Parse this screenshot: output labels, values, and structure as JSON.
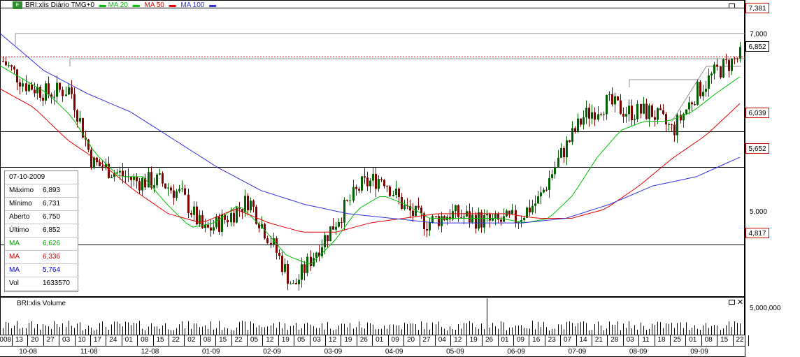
{
  "legend": {
    "symbol": "BRI:xlis Diário TMG+0",
    "ma20": "MA 20",
    "ma50": "MA 50",
    "ma100": "MA 100"
  },
  "volume_title": "BRI:xlis Volume",
  "volume_axis_label": "5,000,000",
  "price_axis_labels": [
    "7,000",
    "5,000"
  ],
  "price_tags": [
    {
      "value": "7,381",
      "color": "#cc0000"
    },
    {
      "value": "6,852",
      "color": "#000000"
    },
    {
      "value": "6,039",
      "color": "#cc0000"
    },
    {
      "value": "5,652",
      "color": "#cc0000"
    },
    {
      "value": "4,817",
      "color": "#cc0000"
    }
  ],
  "info": {
    "date": "07-10-2009",
    "rows": [
      {
        "k": "Máximo",
        "v": "6,893",
        "color": "#000000"
      },
      {
        "k": "Mínimo",
        "v": "6,731",
        "color": "#000000"
      },
      {
        "k": "Aberto",
        "v": "6,750",
        "color": "#000000"
      },
      {
        "k": "Último",
        "v": "6,852",
        "color": "#000000"
      },
      {
        "k": "MA",
        "v": "6,626",
        "color": "#00a000"
      },
      {
        "k": "MA",
        "v": "6,336",
        "color": "#d00000"
      },
      {
        "k": "MA",
        "v": "5,764",
        "color": "#0000cc"
      },
      {
        "k": "Vol",
        "v": "1633570",
        "color": "#000000"
      }
    ]
  },
  "x_day_labels": [
    "2008",
    "13",
    "20",
    "27",
    "03",
    "10",
    "17",
    "24",
    "01",
    "08",
    "15",
    "22",
    "02",
    "08",
    "15",
    "22",
    "05",
    "12",
    "19",
    "05",
    "03",
    "12",
    "19",
    "26",
    "01",
    "09",
    "20",
    "27",
    "04",
    "12",
    "19",
    "26",
    "01",
    "09",
    "16",
    "23",
    "07",
    "14",
    "21",
    "28",
    "03",
    "11",
    "18",
    "25",
    "01",
    "08",
    "15",
    "22"
  ],
  "x_month_labels": [
    "10-08",
    "11-08",
    "12-08",
    "01-09",
    "02-09",
    "03-09",
    "04-09",
    "05-09",
    "06-09",
    "07-09",
    "08-09",
    "09-09"
  ],
  "colors": {
    "ma20": "#00c000",
    "ma50": "#e00000",
    "ma100": "#3030e0",
    "up": "#006000",
    "down": "#800000"
  },
  "chart_data": {
    "type": "line",
    "title": "BRI:xlis Diário TMG+0",
    "ylim": [
      4.25,
      7.4
    ],
    "horizontal_levels": [
      7.381,
      6.852,
      6.039,
      5.652,
      4.817
    ],
    "months": [
      "10-08",
      "11-08",
      "12-08",
      "01-09",
      "02-09",
      "03-09",
      "04-09",
      "05-09",
      "06-09",
      "07-09",
      "08-09",
      "09-09"
    ],
    "series": [
      {
        "name": "BRI:xlis",
        "values": [
          6.8,
          6.55,
          6.45,
          6.5,
          5.7,
          5.6,
          5.5,
          5.5,
          5.35,
          4.95,
          5.1,
          5.3,
          4.85,
          4.35,
          4.75,
          5.1,
          5.45,
          5.55,
          5.2,
          5.05,
          5.15,
          5.1,
          5.05,
          5.1,
          5.3,
          5.8,
          6.2,
          6.35,
          6.25,
          6.25,
          6.05,
          6.45,
          6.7,
          6.85
        ]
      },
      {
        "name": "MA 20",
        "values": [
          6.75,
          6.6,
          6.45,
          6.2,
          5.8,
          5.55,
          5.55,
          5.25,
          5.0,
          5.05,
          5.25,
          5.0,
          4.7,
          4.6,
          4.85,
          5.2,
          5.35,
          5.25,
          5.1,
          5.1,
          5.1,
          5.1,
          5.05,
          5.1,
          5.35,
          5.75,
          6.05,
          6.15,
          6.15,
          6.25,
          6.45,
          6.63
        ]
      },
      {
        "name": "MA 50",
        "values": [
          6.5,
          6.3,
          5.95,
          5.7,
          5.4,
          5.15,
          5.05,
          5.2,
          5.05,
          4.95,
          4.95,
          5.05,
          5.1,
          5.15,
          5.15,
          5.15,
          5.1,
          5.1,
          5.2,
          5.45,
          5.75,
          6.0,
          6.34
        ]
      },
      {
        "name": "MA 100",
        "values": [
          7.1,
          6.7,
          6.45,
          6.25,
          5.95,
          5.65,
          5.4,
          5.25,
          5.15,
          5.1,
          5.05,
          5.05,
          5.05,
          5.1,
          5.25,
          5.45,
          5.55,
          5.76
        ]
      }
    ],
    "volume_ylabel": "5,000,000"
  }
}
